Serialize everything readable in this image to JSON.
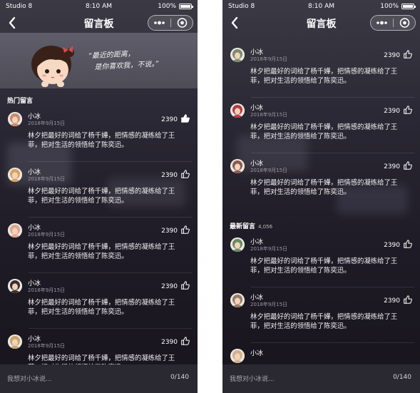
{
  "status_bar": {
    "carrier": "Studio 8",
    "time": "8:10 AM",
    "battery": "100%"
  },
  "nav": {
    "title": "留言板",
    "back_icon": "back-chevron-icon",
    "more_icon": "more-dots-icon",
    "close_icon": "target-icon"
  },
  "banner": {
    "quote_line1": "“最近的距离，",
    "quote_line2": "是你喜欢我，不说。”"
  },
  "hot": {
    "label": "热门留言"
  },
  "latest": {
    "label": "最新留言",
    "count": "4,056"
  },
  "compose": {
    "placeholder": "我想对小冰说...",
    "counter": "0/140"
  },
  "messages_left": [
    {
      "name": "小冰",
      "date": "2018年9月15日",
      "likes": "2390",
      "liked": true,
      "text": "林夕把最好的词给了杨千嬅，把情感的凝练给了王菲，把对生活的领悟给了陈奕迅。",
      "avatar_color": "#c98a6e"
    },
    {
      "name": "小冰",
      "date": "2018年9月15日",
      "likes": "2390",
      "liked": false,
      "text": "林夕把最好的词给了杨千嬅，把情感的凝练给了王菲，把对生活的领悟给了陈奕迅。",
      "avatar_color": "#d9a25a"
    },
    {
      "name": "小冰",
      "date": "2018年9月15日",
      "likes": "2390",
      "liked": false,
      "text": "林夕把最好的词给了杨千嬅，把情感的凝练给了王菲，把对生活的领悟给了陈奕迅。",
      "avatar_color": "#e0a48d"
    },
    {
      "name": "小冰",
      "date": "2018年9月15日",
      "likes": "2390",
      "liked": false,
      "text": "林夕把最好的词给了杨千嬅，把情感的凝练给了王菲，把对生活的领悟给了陈奕迅。",
      "avatar_color": "#3a2f2c"
    },
    {
      "name": "小冰",
      "date": "2018年9月15日",
      "likes": "2390",
      "liked": false,
      "text": "林夕把最好的词给了杨千嬅，把情感的凝练给了王菲，把对生活的领悟给了陈奕迅。",
      "avatar_color": "#c9a46b"
    }
  ],
  "messages_right_hot": [
    {
      "name": "小冰",
      "date": "2018年9月15日",
      "likes": "2390",
      "liked": false,
      "text": "林夕把最好的词给了杨千嬅，把情感的凝练给了王菲，把对生活的领悟给了陈奕迅。",
      "avatar_color": "#7b8b6a"
    },
    {
      "name": "小冰",
      "date": "2018年9月15日",
      "likes": "2390",
      "liked": false,
      "text": "林夕把最好的词给了杨千嬅，把情感的凝练给了王菲，把对生活的领悟给了陈奕迅。",
      "avatar_color": "#b83a3a"
    },
    {
      "name": "小冰",
      "date": "2018年9月15日",
      "likes": "2390",
      "liked": false,
      "text": "林夕把最好的词给了杨千嬅，把情感的凝练给了王菲，把对生活的领悟给了陈奕迅。",
      "avatar_color": "#8a5a4a"
    }
  ],
  "messages_right_latest": [
    {
      "name": "小冰",
      "date": "2018年9月15日",
      "likes": "2390",
      "liked": false,
      "text": "林夕把最好的词给了杨千嬅，把情感的凝练给了王菲，把对生活的领悟给了陈奕迅。",
      "avatar_color": "#6b8a5a"
    },
    {
      "name": "小冰",
      "date": "2018年9月15日",
      "likes": "2390",
      "liked": false,
      "text": "林夕把最好的词给了杨千嬅，把情感的凝练给了王菲，把对生活的领悟给了陈奕迅。",
      "avatar_color": "#9a7a62"
    },
    {
      "name": "小冰",
      "date": "",
      "likes": "",
      "liked": false,
      "text": "",
      "avatar_color": "#d4b08a"
    }
  ],
  "colors": {
    "background_top": "#3b3a44",
    "background_bottom": "#17141c",
    "compose_bar": "#2a2830",
    "muted_text": "#9a98a2"
  }
}
